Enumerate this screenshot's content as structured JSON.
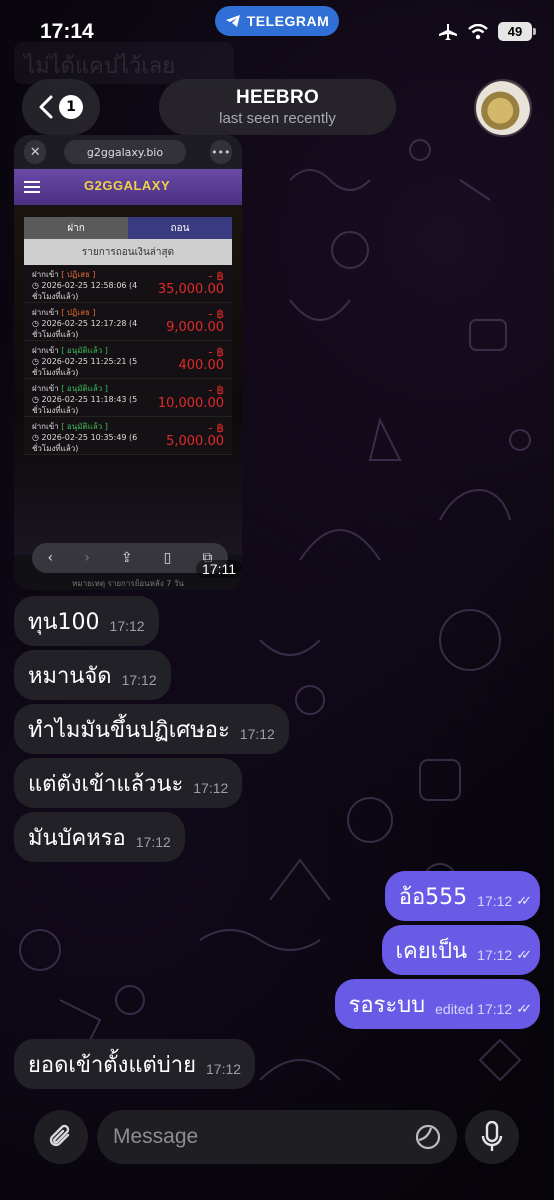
{
  "status_bar": {
    "time": "17:14",
    "app_pill": "TELEGRAM",
    "battery": "49"
  },
  "header": {
    "back_count": "1",
    "name": "HEEBRO",
    "status": "last seen recently"
  },
  "background_banner": "ไม่ได้แคปไว้เลย",
  "screenshot_message": {
    "url": "g2ggalaxy.bio",
    "brand": "G2GGALAXY",
    "tab_deposit": "ฝาก",
    "tab_withdraw": "ถอน",
    "list_title": "รายการถอนเงินล่าสุด",
    "transactions": [
      {
        "type": "ฝากเข้า",
        "tag": "[ ปฏิเสธ ]",
        "tag_kind": "rejected",
        "datetime": "2026-02-25 12:58:06",
        "ago": "(4 ชั่วโมงที่แล้ว)",
        "amount": "35,000.00"
      },
      {
        "type": "ฝากเข้า",
        "tag": "[ ปฏิเสธ ]",
        "tag_kind": "rejected",
        "datetime": "2026-02-25 12:17:28",
        "ago": "(4 ชั่วโมงที่แล้ว)",
        "amount": "9,000.00"
      },
      {
        "type": "ฝากเข้า",
        "tag": "[ อนุมัติแล้ว ]",
        "tag_kind": "approved",
        "datetime": "2026-02-25 11:25:21",
        "ago": "(5 ชั่วโมงที่แล้ว)",
        "amount": "400.00"
      },
      {
        "type": "ฝากเข้า",
        "tag": "[ อนุมัติแล้ว ]",
        "tag_kind": "approved",
        "datetime": "2026-02-25 11:18:43",
        "ago": "(5 ชั่วโมงที่แล้ว)",
        "amount": "10,000.00"
      },
      {
        "type": "ฝากเข้า",
        "tag": "[ อนุมัติแล้ว ]",
        "tag_kind": "approved",
        "datetime": "2026-02-25 10:35:49",
        "ago": "(6 ชั่วโมงที่แล้ว)",
        "amount": "5,000.00"
      }
    ],
    "currency_prefix": "- ฿",
    "note": "หมายเหตุ รายการย้อนหลัง 7 วัน",
    "time": "17:11"
  },
  "messages": [
    {
      "dir": "in",
      "text": "ทุน100",
      "time": "17:12"
    },
    {
      "dir": "in",
      "text": "หมานจัด",
      "time": "17:12"
    },
    {
      "dir": "in",
      "text": "ทำไมมันขึ้นปฏิเศษอะ",
      "time": "17:12"
    },
    {
      "dir": "in",
      "text": "แต่ตังเข้าแล้วนะ",
      "time": "17:12"
    },
    {
      "dir": "in",
      "text": "มันบัคหรอ",
      "time": "17:12"
    },
    {
      "dir": "out",
      "text": "อ้อ555",
      "time": "17:12"
    },
    {
      "dir": "out",
      "text": "เคยเป็น",
      "time": "17:12"
    },
    {
      "dir": "out",
      "text": "รอระบบ",
      "time": "edited 17:12"
    },
    {
      "dir": "in",
      "text": "ยอดเข้าตั้งแต่บ่าย",
      "time": "17:12"
    }
  ],
  "composer": {
    "placeholder": "Message"
  },
  "icons": {
    "back": "chevron-left-icon",
    "attach": "paperclip-icon",
    "sticker": "sticker-icon",
    "mic": "microphone-icon"
  },
  "colors": {
    "outgoing_bubble": "#6a5be6",
    "incoming_bubble": "#222127",
    "telegram_pill": "#2f6fd6"
  }
}
